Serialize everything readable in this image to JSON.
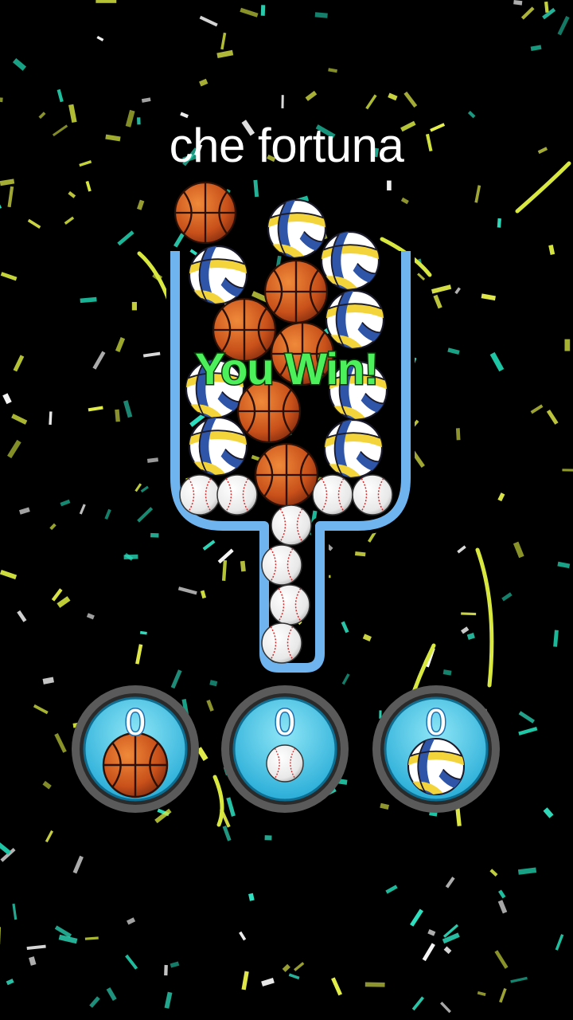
{
  "caption": "che fortuna",
  "result_text": "You Win!",
  "colors": {
    "background": "#000000",
    "container_stroke": "#6fb4ee",
    "win_text": "#4cf05a",
    "counter_fill": "#35c3e4",
    "counter_ring": "#5a5a5a"
  },
  "counters": [
    {
      "ball": "basketball",
      "count": "0"
    },
    {
      "ball": "baseball",
      "count": "0"
    },
    {
      "ball": "volleyball",
      "count": "0"
    }
  ],
  "balls": [
    {
      "type": "basketball"
    },
    {
      "type": "volleyball"
    },
    {
      "type": "volleyball"
    },
    {
      "type": "volleyball"
    },
    {
      "type": "basketball"
    },
    {
      "type": "volleyball"
    },
    {
      "type": "basketball"
    },
    {
      "type": "basketball"
    },
    {
      "type": "volleyball"
    },
    {
      "type": "volleyball"
    },
    {
      "type": "basketball"
    },
    {
      "type": "volleyball"
    },
    {
      "type": "volleyball"
    },
    {
      "type": "basketball"
    },
    {
      "type": "baseball"
    },
    {
      "type": "baseball"
    },
    {
      "type": "baseball"
    },
    {
      "type": "baseball"
    },
    {
      "type": "baseball"
    },
    {
      "type": "baseball"
    },
    {
      "type": "baseball"
    },
    {
      "type": "baseball"
    }
  ]
}
